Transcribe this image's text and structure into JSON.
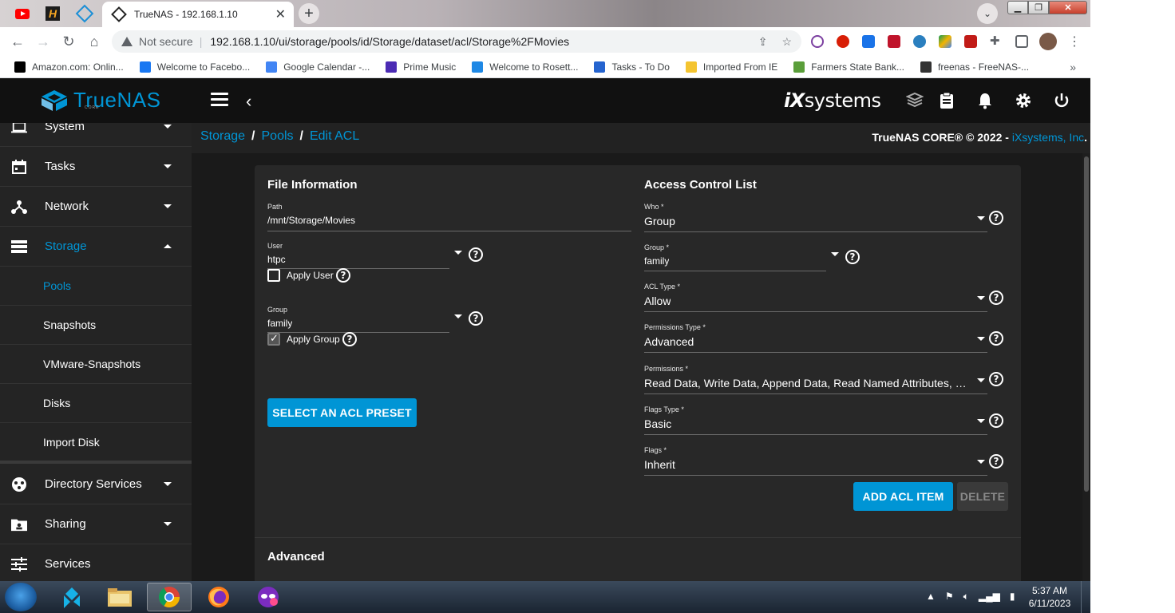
{
  "browser": {
    "active_tab_title": "TrueNAS - 192.168.1.10",
    "address": {
      "security_label": "Not secure",
      "url": "192.168.1.10/ui/storage/pools/id/Storage/dataset/acl/Storage%2FMovies"
    },
    "bookmarks": [
      {
        "label": "Amazon.com: Onlin...",
        "color": "#000000"
      },
      {
        "label": "Welcome to Facebo...",
        "color": "#1877f2"
      },
      {
        "label": "Google Calendar -...",
        "color": "#4285f4"
      },
      {
        "label": "Prime Music",
        "color": "#4b2bb4"
      },
      {
        "label": "Welcome to Rosett...",
        "color": "#1e88e5"
      },
      {
        "label": "Tasks - To Do",
        "color": "#2564cf"
      },
      {
        "label": "Imported From IE",
        "color": "#f4c430"
      },
      {
        "label": "Farmers State Bank...",
        "color": "#5a9e3a"
      },
      {
        "label": "freenas - FreeNAS-...",
        "color": "#333333"
      }
    ],
    "bookmarks_more": "»"
  },
  "app": {
    "brand": "TrueNAS",
    "brand_sub": "CORE",
    "vendor_logo_prefix": "iX",
    "vendor_logo_suffix": "systems",
    "accent_color": "#0095d5",
    "sidebar": {
      "items": [
        {
          "label": "System",
          "icon": "laptop-icon"
        },
        {
          "label": "Tasks",
          "icon": "calendar-icon"
        },
        {
          "label": "Network",
          "icon": "network-icon"
        },
        {
          "label": "Storage",
          "icon": "storage-icon"
        },
        {
          "label": "Directory Services",
          "icon": "directory-icon"
        },
        {
          "label": "Sharing",
          "icon": "folder-share-icon"
        },
        {
          "label": "Services",
          "icon": "tune-icon"
        }
      ],
      "storage_subitems": [
        "Pools",
        "Snapshots",
        "VMware-Snapshots",
        "Disks",
        "Import Disk"
      ]
    },
    "breadcrumb": {
      "items": [
        "Storage",
        "Pools",
        "Edit ACL"
      ]
    },
    "copyright": {
      "text": "TrueNAS CORE® © 2022 - ",
      "link": "iXsystems, Inc",
      "suffix": "."
    },
    "file_info": {
      "title": "File Information",
      "path_label": "Path",
      "path_value": "/mnt/Storage/Movies",
      "user_label": "User",
      "user_value": "htpc",
      "apply_user_label": "Apply User",
      "apply_user_checked": false,
      "group_label": "Group",
      "group_value": "family",
      "apply_group_label": "Apply Group",
      "apply_group_checked": true,
      "preset_button": "SELECT AN ACL PRESET"
    },
    "acl": {
      "title": "Access Control List",
      "who_label": "Who *",
      "who_value": "Group",
      "group_label": "Group *",
      "group_value": "family",
      "acl_type_label": "ACL Type *",
      "acl_type_value": "Allow",
      "perm_type_label": "Permissions Type *",
      "perm_type_value": "Advanced",
      "permissions_label": "Permissions *",
      "permissions_value": "Read Data, Write Data, Append Data, Read Named Attributes, Wri...",
      "flags_type_label": "Flags Type *",
      "flags_type_value": "Basic",
      "flags_label": "Flags *",
      "flags_value": "Inherit",
      "add_button": "ADD ACL ITEM",
      "delete_button": "DELETE"
    },
    "advanced": {
      "title": "Advanced"
    }
  },
  "taskbar": {
    "time": "5:37 AM",
    "date": "6/11/2023"
  }
}
